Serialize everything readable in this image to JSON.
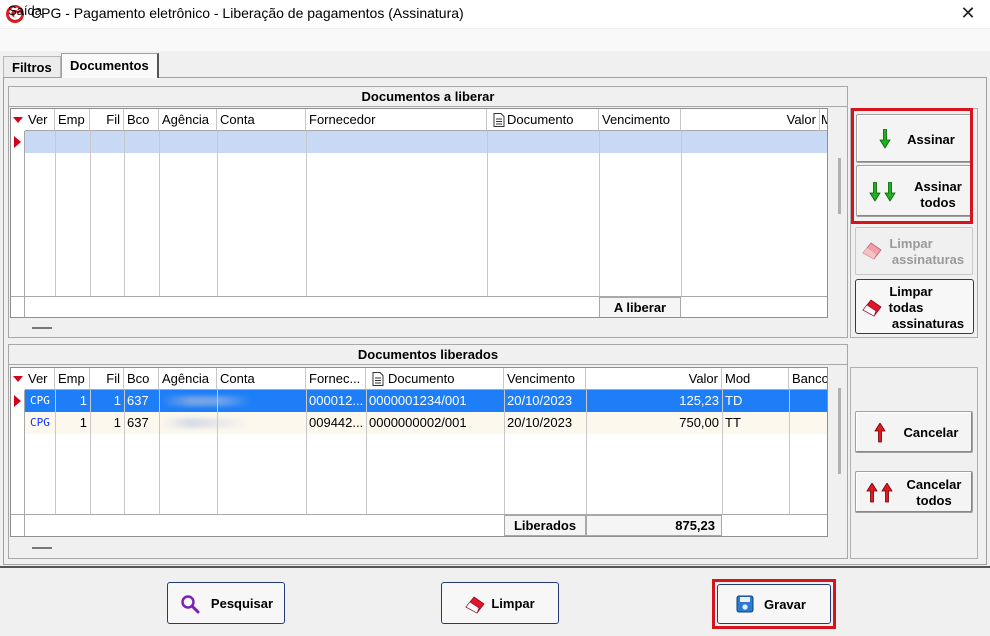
{
  "window": {
    "title": "CPG - Pagamento eletrônico - Liberação de pagamentos (Assinatura)",
    "close_glyph": "✕"
  },
  "menu": {
    "saida": "Saída"
  },
  "tabs": {
    "filtros": "Filtros",
    "documentos": "Documentos"
  },
  "top_panel": {
    "title": "Documentos a liberar",
    "columns": [
      "Ver",
      "Emp",
      "Fil",
      "Bco",
      "Agência",
      "Conta",
      "Fornecedor",
      "Documento",
      "Vencimento",
      "Valor",
      "M"
    ],
    "footer_label": "A liberar"
  },
  "bottom_panel": {
    "title": "Documentos liberados",
    "columns": [
      "Ver",
      "Emp",
      "Fil",
      "Bco",
      "Agência",
      "Conta",
      "Fornec...",
      "Documento",
      "Vencimento",
      "Valor",
      "Mod",
      "Banco"
    ],
    "rows": [
      {
        "ver": "CPG",
        "emp": "1",
        "fil": "1",
        "bco": "637",
        "fornecedor": "000012...",
        "documento": "0000001234/001",
        "vencimento": "20/10/2023",
        "valor": "125,23",
        "mod": "TD",
        "selected": true
      },
      {
        "ver": "CPG",
        "emp": "1",
        "fil": "1",
        "bco": "637",
        "fornecedor": "009442...",
        "documento": "0000000002/001",
        "vencimento": "20/10/2023",
        "valor": "750,00",
        "mod": "TT",
        "selected": false
      }
    ],
    "footer_label": "Liberados",
    "footer_total": "875,23"
  },
  "side_buttons": {
    "assinar": "Assinar",
    "assinar_todos_1": "Assinar",
    "assinar_todos_2": "todos",
    "limpar_assinaturas_1": "Limpar",
    "limpar_assinaturas_2": "assinaturas",
    "limpar_todas_1": "Limpar",
    "limpar_todas_2": "todas",
    "limpar_todas_3": "assinaturas",
    "cancelar": "Cancelar",
    "cancelar_todos_1": "Cancelar",
    "cancelar_todos_2": "todos"
  },
  "bottom_buttons": {
    "pesquisar": "Pesquisar",
    "limpar": "Limpar",
    "gravar": "Gravar"
  },
  "colors": {
    "selection": "#1e7ef7",
    "highlight_frame": "#d7141e",
    "accent_green": "#1db31d",
    "accent_red": "#d0021b",
    "row_current": "#c7d9f5"
  },
  "icons": [
    "logo-icon",
    "close-icon",
    "document-icon",
    "green-down-arrow-icon",
    "green-double-down-arrow-icon",
    "eraser-icon",
    "red-up-arrow-icon",
    "red-double-up-arrow-icon",
    "magnifier-icon",
    "floppy-disk-icon"
  ]
}
